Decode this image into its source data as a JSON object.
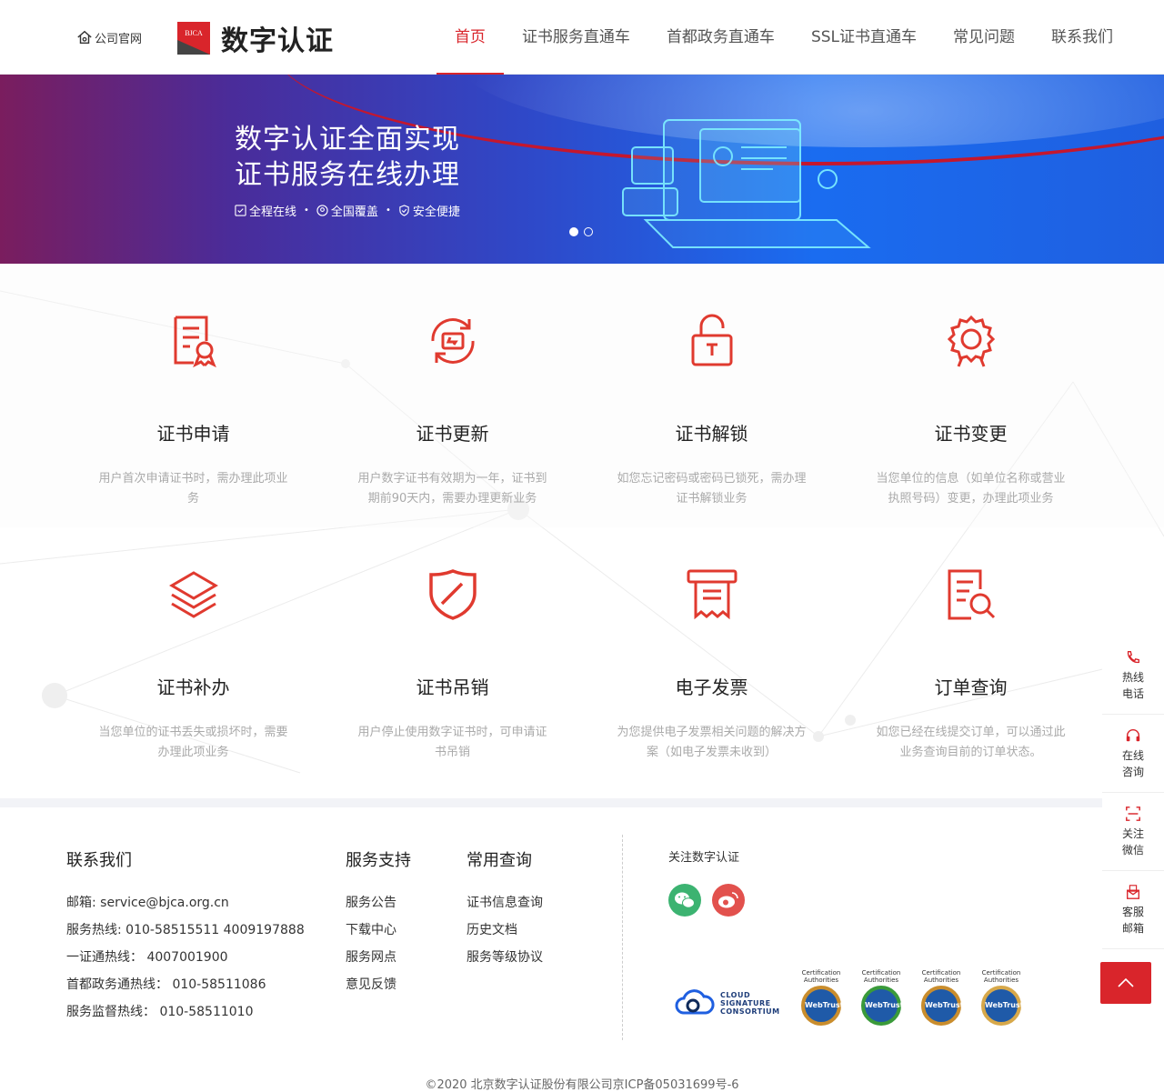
{
  "header": {
    "home_label": "公司官网",
    "logo_badge": "BJCA",
    "logo_text": "数字认证",
    "nav": [
      {
        "label": "首页",
        "active": true
      },
      {
        "label": "证书服务直通车"
      },
      {
        "label": "首都政务直通车"
      },
      {
        "label": "SSL证书直通车"
      },
      {
        "label": "常见问题"
      },
      {
        "label": "联系我们"
      }
    ]
  },
  "banner": {
    "line1": "数字认证全面实现",
    "line2": "证书服务在线办理",
    "tags": [
      "全程在线",
      "全国覆盖",
      "安全便捷"
    ],
    "separator": "•",
    "slides": 2,
    "active_slide": 1
  },
  "services": [
    {
      "icon": "certificate-icon",
      "title": "证书申请",
      "desc": "用户首次申请证书时，需办理此项业务"
    },
    {
      "icon": "refresh-icon",
      "title": "证书更新",
      "desc": "用户数字证书有效期为一年，证书到期前90天内，需要办理更新业务"
    },
    {
      "icon": "unlock-icon",
      "title": "证书解锁",
      "desc": "如您忘记密码或密码已锁死，需办理证书解锁业务"
    },
    {
      "icon": "badge-icon",
      "title": "证书变更",
      "desc": "当您单位的信息（如单位名称或营业执照号码）变更，办理此项业务"
    },
    {
      "icon": "layers-icon",
      "title": "证书补办",
      "desc": "当您单位的证书丢失或损坏时，需要办理此项业务"
    },
    {
      "icon": "shield-icon",
      "title": "证书吊销",
      "desc": "用户停止使用数字证书时，可申请证书吊销"
    },
    {
      "icon": "invoice-icon",
      "title": "电子发票",
      "desc": "为您提供电子发票相关问题的解决方案（如电子发票未收到）"
    },
    {
      "icon": "search-doc-icon",
      "title": "订单查询",
      "desc": "如您已经在线提交订单，可以通过此业务查询目前的订单状态。"
    }
  ],
  "footer": {
    "contact": {
      "title": "联系我们",
      "lines": [
        "邮箱: service@bjca.org.cn",
        "服务热线: 010-58515511 4009197888",
        "一证通热线：  4007001900",
        "首都政务通热线：  010-58511086",
        "服务监督热线：  010-58511010"
      ]
    },
    "support": {
      "title": "服务支持",
      "links": [
        "服务公告",
        "下载中心",
        "服务网点",
        "意见反馈"
      ]
    },
    "query": {
      "title": "常用查询",
      "links": [
        "证书信息查询",
        "历史文档",
        "服务等级协议"
      ]
    },
    "follow": "关注数字认证",
    "social": [
      {
        "icon": "wechat-icon",
        "color": "#3cb371"
      },
      {
        "icon": "weibo-icon",
        "color": "#e2514d"
      }
    ],
    "csc": [
      "CLOUD",
      "SIGNATURE",
      "CONSORTIUM"
    ],
    "badges": [
      {
        "top": "Certification Authorities",
        "name": "WebTrust"
      },
      {
        "top": "Certification Authorities",
        "name": "WebTrust"
      },
      {
        "top": "Certification Authorities",
        "name": "WebTrust"
      },
      {
        "top": "Certification Authorities",
        "name": "WebTrust"
      }
    ],
    "copyright": "©2020 北京数字认证股份有限公司京ICP备05031699号-6"
  },
  "side": [
    {
      "icon": "phone-icon",
      "l1": "热线",
      "l2": "电话"
    },
    {
      "icon": "headset-icon",
      "l1": "在线",
      "l2": "咨询"
    },
    {
      "icon": "scan-icon",
      "l1": "关注",
      "l2": "微信"
    },
    {
      "icon": "mail-icon",
      "l1": "客服",
      "l2": "邮箱"
    }
  ],
  "colors": {
    "brand_red": "#d9252b",
    "banner_blue": "#1f5fe0"
  }
}
